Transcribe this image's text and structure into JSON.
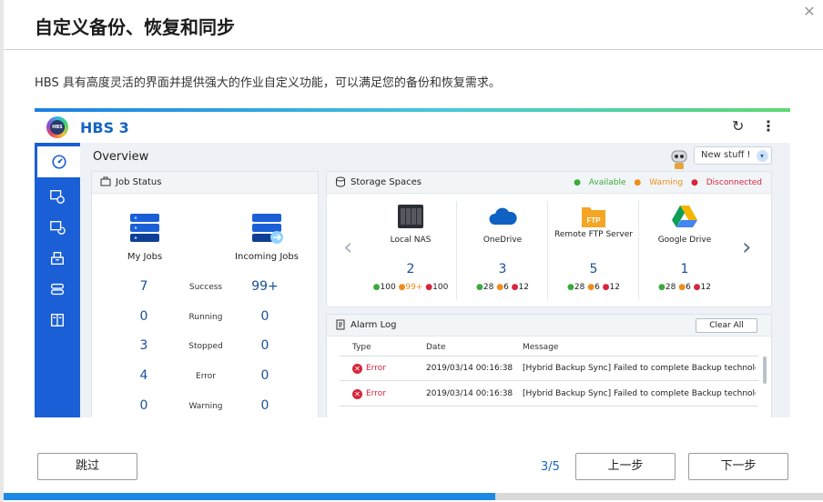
{
  "dialog": {
    "title": "自定义备份、恢复和同步",
    "description": "HBS 具有高度灵活的界面并提供强大的作业自定义功能，可以满足您的备份和恢复需求。",
    "close_icon": "close-icon"
  },
  "app": {
    "name": "HBS 3",
    "logo_text": "HBS",
    "overview_title": "Overview",
    "new_stuff": "New stuff !",
    "header_icons": [
      "refresh-icon",
      "more-vertical-icon"
    ],
    "sidebar_icons": [
      "dashboard-icon",
      "backup-icon",
      "sync-icon",
      "restore-icon",
      "services-icon",
      "storage-icon"
    ]
  },
  "job_status": {
    "title": "Job Status",
    "my_jobs_label": "My Jobs",
    "incoming_jobs_label": "Incoming Jobs",
    "rows": [
      {
        "label": "Success",
        "my": "7",
        "incoming": "99+"
      },
      {
        "label": "Running",
        "my": "0",
        "incoming": "0"
      },
      {
        "label": "Stopped",
        "my": "3",
        "incoming": "0"
      },
      {
        "label": "Error",
        "my": "4",
        "incoming": "0"
      },
      {
        "label": "Warning",
        "my": "0",
        "incoming": "0"
      }
    ]
  },
  "storage": {
    "title": "Storage Spaces",
    "legend": {
      "available": "Available",
      "warning": "Warning",
      "disconnected": "Disconnected"
    },
    "colors": {
      "available": "#3caa3c",
      "warning": "#f08c1c",
      "disconnected": "#d7263d"
    },
    "spaces": [
      {
        "name": "Local NAS",
        "count": "2",
        "available": "100",
        "warning": "99+",
        "disconnected": "100"
      },
      {
        "name": "OneDrive",
        "count": "3",
        "available": "28",
        "warning": "6",
        "disconnected": "12"
      },
      {
        "name": "Remote FTP Server",
        "count": "5",
        "available": "28",
        "warning": "6",
        "disconnected": "12",
        "icon_text": "FTP"
      },
      {
        "name": "Google Drive",
        "count": "1",
        "available": "28",
        "warning": "6",
        "disconnected": "12"
      }
    ]
  },
  "alarm_log": {
    "title": "Alarm Log",
    "clear_all": "Clear All",
    "columns": {
      "type": "Type",
      "date": "Date",
      "message": "Message"
    },
    "rows": [
      {
        "type": "Error",
        "date": "2019/03/14 00:16:38",
        "message": "[Hybrid Backup Sync] Failed to complete Backup technologic..."
      },
      {
        "type": "Error",
        "date": "2019/03/14 00:16:38",
        "message": "[Hybrid Backup Sync] Failed to complete Backup technologic..."
      }
    ]
  },
  "footer": {
    "skip": "跳过",
    "page": "3/5",
    "prev": "上一步",
    "next": "下一步",
    "progress_fraction": 0.6
  },
  "colors": {
    "accent": "#1565c0",
    "sidebar": "#1a5fd6",
    "error": "#d7263d"
  }
}
